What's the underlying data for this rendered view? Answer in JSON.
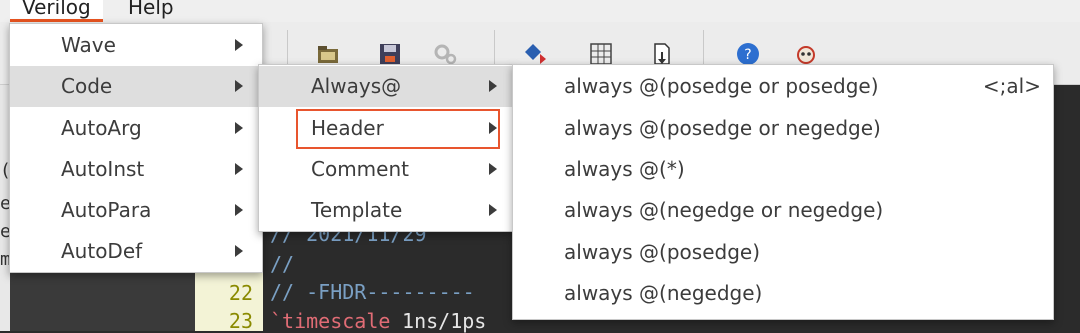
{
  "menubar": {
    "items": [
      "Verilog",
      "Help"
    ]
  },
  "menu1": {
    "items": [
      {
        "label": "Wave",
        "highlighted": false
      },
      {
        "label": "Code",
        "highlighted": true
      },
      {
        "label": "AutoArg",
        "highlighted": false
      },
      {
        "label": "AutoInst",
        "highlighted": false
      },
      {
        "label": "AutoPara",
        "highlighted": false
      },
      {
        "label": "AutoDef",
        "highlighted": false
      }
    ]
  },
  "menu2": {
    "items": [
      {
        "label": "Always@",
        "highlighted": true
      },
      {
        "label": "Header",
        "highlighted": false,
        "outlined": true
      },
      {
        "label": "Comment",
        "highlighted": false
      },
      {
        "label": "Template",
        "highlighted": false
      }
    ]
  },
  "menu3": {
    "items": [
      {
        "label": "always @(posedge or posedge)",
        "accel": "<;al>"
      },
      {
        "label": "always @(posedge or negedge)",
        "accel": ""
      },
      {
        "label": "always @(*)",
        "accel": ""
      },
      {
        "label": "always @(negedge or negedge)",
        "accel": ""
      },
      {
        "label": "always @(posedge)",
        "accel": ""
      },
      {
        "label": "always @(negedge)",
        "accel": ""
      }
    ]
  },
  "editor": {
    "line_numbers": [
      "22",
      "23"
    ],
    "lines": {
      "l1": "// 2021/11/29",
      "l2": "//",
      "l3": "// -FHDR---------",
      "l4_kw": "`timescale",
      "l4_rest": " 1ns/1ps"
    },
    "left_strip_chars": [
      "(",
      "e",
      "e",
      "m"
    ]
  },
  "colors": {
    "accent": "#e95420",
    "outline": "#e8552e",
    "menu_highlight": "#dedede"
  }
}
